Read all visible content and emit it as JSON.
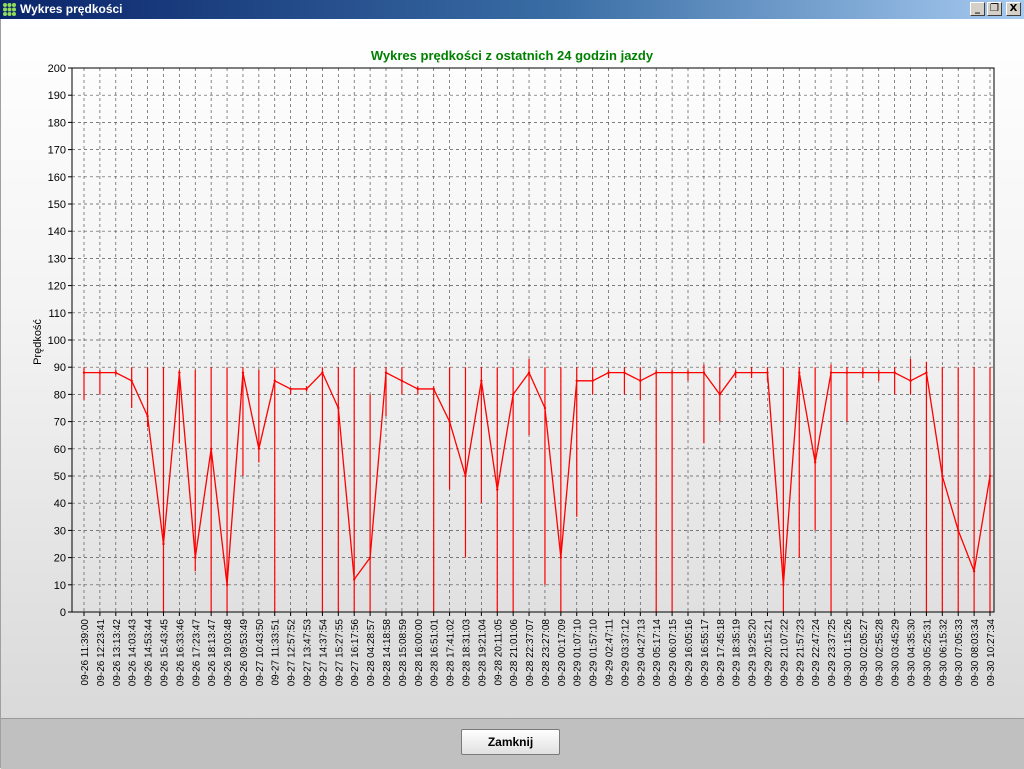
{
  "window": {
    "title": "Wykres prędkości",
    "controls": {
      "minimize": "_",
      "restore": "❐",
      "close": "X"
    }
  },
  "footer": {
    "close_label": "Zamknij"
  },
  "colors": {
    "series": "#ff0000",
    "title": "#008000",
    "titlebar_start": "#0a246a",
    "titlebar_end": "#a6caf0"
  },
  "chart_data": {
    "type": "line",
    "title": "Wykres prędkości z ostatnich 24 godzin jazdy",
    "xlabel": "",
    "ylabel": "Prędkość",
    "ylim": [
      0,
      200
    ],
    "yticks": [
      0,
      10,
      20,
      30,
      40,
      50,
      60,
      70,
      80,
      90,
      100,
      110,
      120,
      130,
      140,
      150,
      160,
      170,
      180,
      190,
      200
    ],
    "grid": true,
    "legend": "none",
    "categories": [
      "09-26 11:39:00",
      "09-26 12:23:41",
      "09-26 13:13:42",
      "09-26 14:03:43",
      "09-26 14:53:44",
      "09-26 15:43:45",
      "09-26 16:33:46",
      "09-26 17:23:47",
      "09-26 18:13:47",
      "09-26 19:03:48",
      "09-26 09:53:49",
      "09-27 10:43:50",
      "09-27 11:33:51",
      "09-27 12:57:52",
      "09-27 13:47:53",
      "09-27 14:37:54",
      "09-27 15:27:55",
      "09-27 16:17:56",
      "09-28 04:28:57",
      "09-28 14:18:58",
      "09-28 15:08:59",
      "09-28 16:00:00",
      "09-28 16:51:01",
      "09-28 17:41:02",
      "09-28 18:31:03",
      "09-28 19:21:04",
      "09-28 20:11:05",
      "09-28 21:01:06",
      "09-28 22:37:07",
      "09-28 23:27:08",
      "09-29 00:17:09",
      "09-29 01:07:10",
      "09-29 01:57:10",
      "09-29 02:47:11",
      "09-29 03:37:12",
      "09-29 04:27:13",
      "09-29 05:17:14",
      "09-29 06:07:15",
      "09-29 16:05:16",
      "09-29 16:55:17",
      "09-29 17:45:18",
      "09-29 18:35:19",
      "09-29 19:25:20",
      "09-29 20:15:21",
      "09-29 21:07:22",
      "09-29 21:57:23",
      "09-29 22:47:24",
      "09-29 23:37:25",
      "09-30 01:15:26",
      "09-30 02:05:27",
      "09-30 02:55:28",
      "09-30 03:45:29",
      "09-30 04:35:30",
      "09-30 05:25:31",
      "09-30 06:15:32",
      "09-30 07:05:33",
      "09-30 08:03:34",
      "09-30 10:27:34"
    ],
    "series": [
      {
        "values": [
          88,
          88,
          88,
          85,
          72,
          25,
          88,
          20,
          60,
          10,
          88,
          60,
          85,
          82,
          82,
          88,
          75,
          12,
          20,
          88,
          85,
          82,
          82,
          70,
          50,
          85,
          45,
          80,
          88,
          75,
          20,
          85,
          85,
          88,
          88,
          85,
          88,
          88,
          88,
          88,
          80,
          88,
          88,
          88,
          10,
          88,
          55,
          88,
          88,
          88,
          88,
          88,
          85,
          88,
          50,
          30,
          15,
          50
        ],
        "min": [
          78,
          80,
          87,
          75,
          68,
          0,
          62,
          15,
          0,
          0,
          50,
          55,
          0,
          80,
          81,
          0,
          0,
          0,
          0,
          72,
          80,
          80,
          0,
          45,
          20,
          40,
          0,
          0,
          65,
          10,
          0,
          35,
          80,
          86,
          80,
          78,
          0,
          0,
          85,
          62,
          70,
          86,
          86,
          85,
          0,
          20,
          30,
          0,
          70,
          86,
          85,
          80,
          80,
          0,
          0,
          0,
          0,
          0
        ],
        "max": [
          90,
          89,
          89,
          90,
          90,
          90,
          89,
          89,
          90,
          90,
          90,
          89,
          90,
          82,
          83,
          90,
          90,
          90,
          80,
          90,
          90,
          83,
          83,
          90,
          90,
          90,
          90,
          90,
          93,
          90,
          90,
          90,
          90,
          89,
          90,
          90,
          89,
          89,
          89,
          91,
          90,
          89,
          90,
          90,
          90,
          90,
          90,
          91,
          90,
          90,
          89,
          90,
          93,
          92,
          90,
          90,
          90,
          90
        ]
      }
    ]
  }
}
